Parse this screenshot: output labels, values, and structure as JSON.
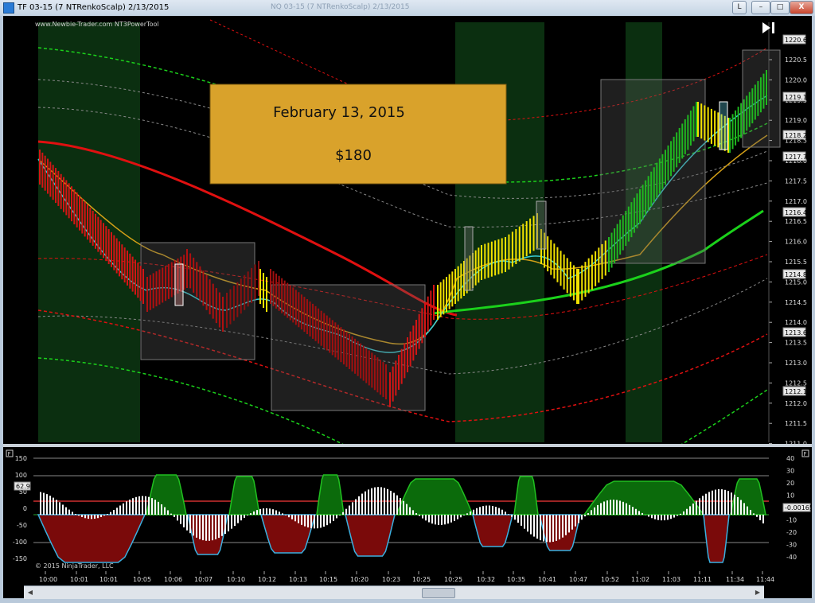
{
  "window": {
    "title": "TF 03-15 (7 NTRenkoScalp)  2/13/2015",
    "ghost_title": "NQ 03-15 (7 NTRenkoScalp) 2/13/2015",
    "buttons": {
      "layout": "L",
      "minimize": "–",
      "maximize": "□",
      "close": "X"
    }
  },
  "chart": {
    "watermark": "www.Newbie-Trader.com NT3PowerTool",
    "copyright": "© 2015 NinjaTrader, LLC",
    "banner": {
      "date": "February 13, 2015",
      "amount": "$180"
    },
    "panel_flag": "F",
    "price_axis": [
      "1220.5",
      "1220.0",
      "1219.5",
      "1219.0",
      "1218.5",
      "1218.0",
      "1217.5",
      "1217.0",
      "1216.5",
      "1216.0",
      "1215.5",
      "1215.0",
      "1214.5",
      "1214.0",
      "1213.5",
      "1213.0",
      "1212.5",
      "1212.0",
      "1211.5",
      "1211.0"
    ],
    "price_tags": [
      "1220.6",
      "1219.1",
      "1218.2",
      "1217.7",
      "1216.4",
      "1214.8",
      "1213.6",
      "1212.1"
    ],
    "osc_left_axis": [
      "150",
      "100",
      "50",
      "0",
      "-50",
      "-100",
      "-150"
    ],
    "osc_right_axis": [
      "40",
      "30",
      "20",
      "10",
      "0",
      "-10",
      "-20",
      "-30",
      "-40"
    ],
    "osc_left_tag": "62.9",
    "osc_right_tag": "-0.00165",
    "time_labels": [
      "10:00",
      "10:01",
      "10:01",
      "10:05",
      "10:06",
      "10:07",
      "10:10",
      "10:12",
      "10:13",
      "10:15",
      "10:20",
      "10:23",
      "10:25",
      "10:25",
      "10:32",
      "10:35",
      "10:41",
      "10:47",
      "10:52",
      "11:02",
      "11:03",
      "11:11",
      "11:34",
      "11:44"
    ],
    "colors": {
      "up": "#1bd11b",
      "down": "#e01010",
      "warn": "#f2e200",
      "cyan": "#39d0d8",
      "gold": "#d4a017",
      "banner": "#d9a22b"
    }
  }
}
